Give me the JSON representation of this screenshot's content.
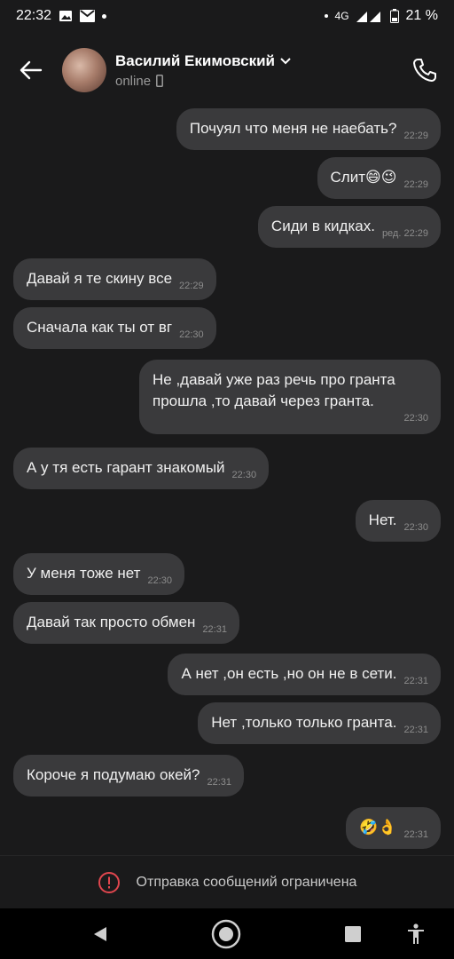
{
  "status_bar": {
    "time": "22:32",
    "network": "4G",
    "battery": "21 %"
  },
  "header": {
    "contact_name": "Василий Екимовский",
    "presence": "online"
  },
  "messages": [
    {
      "dir": "out",
      "text": "Почуял что меня не наебать?",
      "time": "22:29"
    },
    {
      "dir": "out",
      "text": "Слит😄😉",
      "time": "22:29"
    },
    {
      "dir": "out",
      "text": "Сиди в кидках.",
      "time": "ред. 22:29"
    },
    {
      "dir": "in",
      "text": "Давай я те скину все",
      "time": "22:29"
    },
    {
      "dir": "in",
      "text": "Сначала как ты от вг",
      "time": "22:30"
    },
    {
      "dir": "out",
      "text": "Не ,давай уже раз речь про гранта прошла ,то давай через гранта.",
      "time": "22:30"
    },
    {
      "dir": "in",
      "text": "А у тя есть гарант знакомый",
      "time": "22:30"
    },
    {
      "dir": "out",
      "text": "Нет.",
      "time": "22:30"
    },
    {
      "dir": "in",
      "text": "У меня тоже нет",
      "time": "22:30"
    },
    {
      "dir": "in",
      "text": "Давай так просто обмен",
      "time": "22:31"
    },
    {
      "dir": "out",
      "text": "А нет ,он есть ,но он не в сети.",
      "time": "22:31"
    },
    {
      "dir": "out",
      "text": "Нет ,только только гранта.",
      "time": "22:31"
    },
    {
      "dir": "in",
      "text": "Короче я подумаю окей?",
      "time": "22:31"
    },
    {
      "dir": "out",
      "text": "🤣👌",
      "time": "22:31"
    }
  ],
  "footer": {
    "restriction_text": "Отправка сообщений ограничена"
  },
  "colors": {
    "background": "#1a1a1b",
    "bubble": "#3a3a3c",
    "warning_icon": "#e0464e"
  }
}
